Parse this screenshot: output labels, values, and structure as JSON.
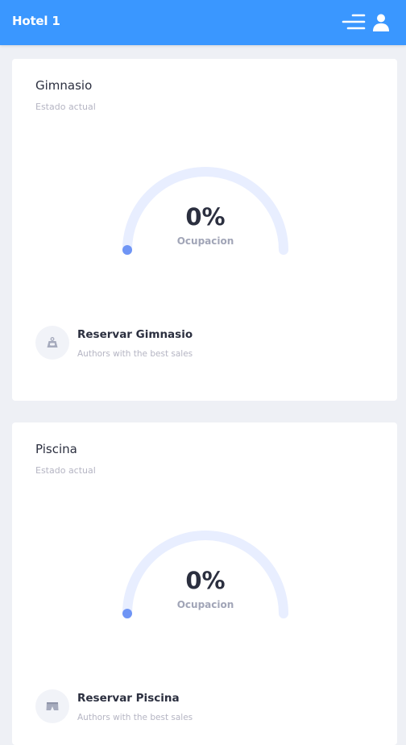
{
  "header": {
    "title": "Hotel 1",
    "menu_icon": "menu-lines-icon",
    "user_icon": "user-icon",
    "background": "#3a97ff"
  },
  "facilities": [
    {
      "name": "Gimnasio",
      "status_label": "Estado actual",
      "occupancy_percent": 0,
      "occupancy_value": "0%",
      "occupancy_label": "Ocupacion",
      "action_title": "Reservar Gimnasio",
      "action_subtitle": "Authors with the best sales",
      "icon": "dumbbell-weight-icon"
    },
    {
      "name": "Piscina",
      "status_label": "Estado actual",
      "occupancy_percent": 0,
      "occupancy_value": "0%",
      "occupancy_label": "Ocupacion",
      "action_title": "Reservar Piscina",
      "action_subtitle": "Authors with the best sales",
      "icon": "swim-shorts-icon"
    }
  ],
  "colors": {
    "gauge_track": "#e8eeff",
    "gauge_fill": "#6f95f5"
  }
}
